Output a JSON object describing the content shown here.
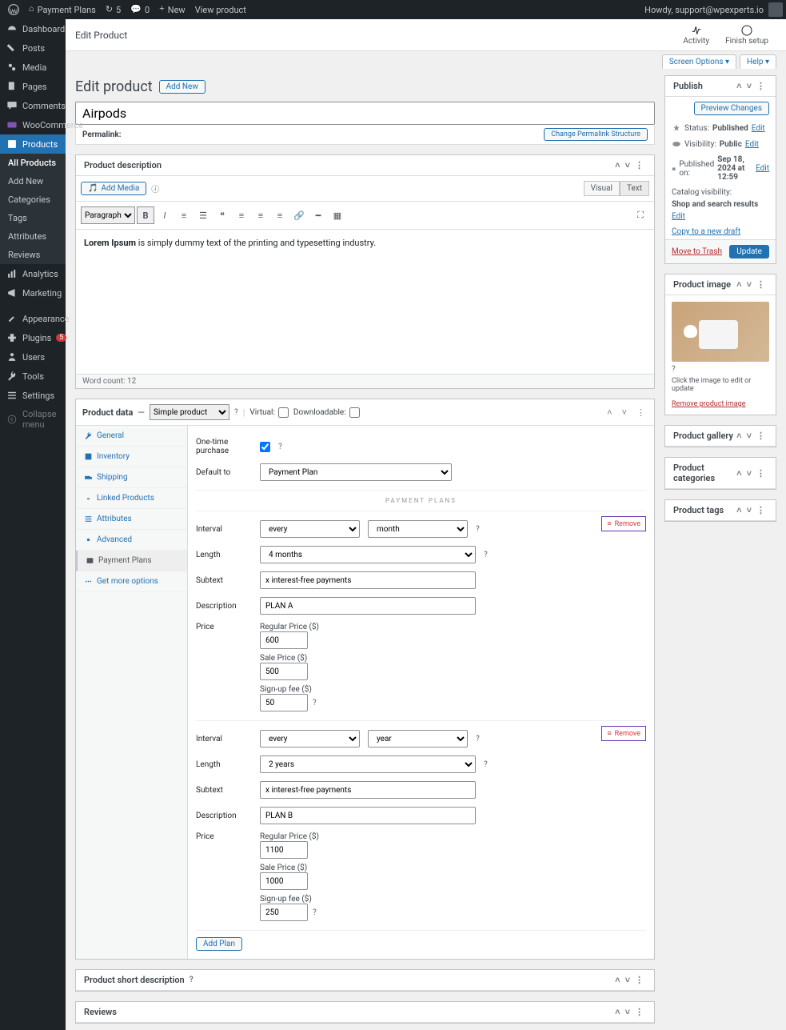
{
  "adminbar": {
    "site": "Payment Plans",
    "updates": "5",
    "comments": "0",
    "new": "New",
    "view": "View product",
    "howdy": "Howdy, support@wpexperts.io"
  },
  "menu": {
    "dashboard": "Dashboard",
    "posts": "Posts",
    "media": "Media",
    "pages": "Pages",
    "comments": "Comments",
    "woo": "WooCommerce",
    "products": "Products",
    "sub": {
      "all": "All Products",
      "add": "Add New",
      "cat": "Categories",
      "tags": "Tags",
      "attr": "Attributes",
      "rev": "Reviews"
    },
    "analytics": "Analytics",
    "marketing": "Marketing",
    "appearance": "Appearance",
    "plugins": "Plugins",
    "plugins_n": "5",
    "users": "Users",
    "tools": "Tools",
    "settings": "Settings",
    "collapse": "Collapse menu"
  },
  "context": {
    "title": "Edit Product",
    "activity": "Activity",
    "finish": "Finish setup"
  },
  "tabs": {
    "screen": "Screen Options ▾",
    "help": "Help ▾"
  },
  "page": {
    "heading": "Edit product",
    "addnew": "Add New",
    "title_value": "Airpods",
    "permalink_label": "Permalink:",
    "permalink_btn": "Change Permalink Structure"
  },
  "editor": {
    "box_title": "Product description",
    "add_media": "Add Media",
    "visual": "Visual",
    "text": "Text",
    "paragraph": "Paragraph",
    "content_bold": "Lorem Ipsum",
    "content_rest": " is simply dummy text of the printing and typesetting industry.",
    "footer": "Word count: 12"
  },
  "pdata": {
    "label": "Product data",
    "type": "Simple product",
    "virtual": "Virtual:",
    "download": "Downloadable:",
    "tabs": {
      "general": "General",
      "inventory": "Inventory",
      "shipping": "Shipping",
      "linked": "Linked Products",
      "attributes": "Attributes",
      "advanced": "Advanced",
      "plans": "Payment Plans",
      "more": "Get more options"
    },
    "one_time": "One-time purchase",
    "default_to": "Default to",
    "default_val": "Payment Plan",
    "section": "PAYMENT PLANS",
    "remove": "Remove",
    "interval": "Interval",
    "length": "Length",
    "subtext": "Subtext",
    "desc": "Description",
    "price": "Price",
    "reg": "Regular Price ($)",
    "sale": "Sale Price ($)",
    "signup": "Sign-up fee ($)",
    "addplan": "Add Plan",
    "plan1": {
      "int1": "every",
      "int2": "month",
      "len": "4 months",
      "sub": "x interest-free payments",
      "desc": "PLAN A",
      "reg": "600",
      "sale": "500",
      "signup": "50"
    },
    "plan2": {
      "int1": "every",
      "int2": "year",
      "len": "2 years",
      "sub": "x interest-free payments",
      "desc": "PLAN B",
      "reg": "1100",
      "sale": "1000",
      "signup": "250"
    }
  },
  "short": {
    "title": "Product short description"
  },
  "reviews": {
    "title": "Reviews"
  },
  "publish": {
    "title": "Publish",
    "preview": "Preview Changes",
    "status_l": "Status:",
    "status_v": "Published",
    "edit": "Edit",
    "vis_l": "Visibility:",
    "vis_v": "Public",
    "pub_l": "Published on:",
    "pub_v": "Sep 18, 2024 at 12:59",
    "cat_l": "Catalog visibility:",
    "cat_v": "Shop and search results",
    "copy": "Copy to a new draft",
    "trash": "Move to Trash",
    "update": "Update"
  },
  "pimage": {
    "title": "Product image",
    "hint": "Click the image to edit or update",
    "remove": "Remove product image"
  },
  "boxes": {
    "gallery": "Product gallery",
    "cats": "Product categories",
    "ptags": "Product tags"
  }
}
